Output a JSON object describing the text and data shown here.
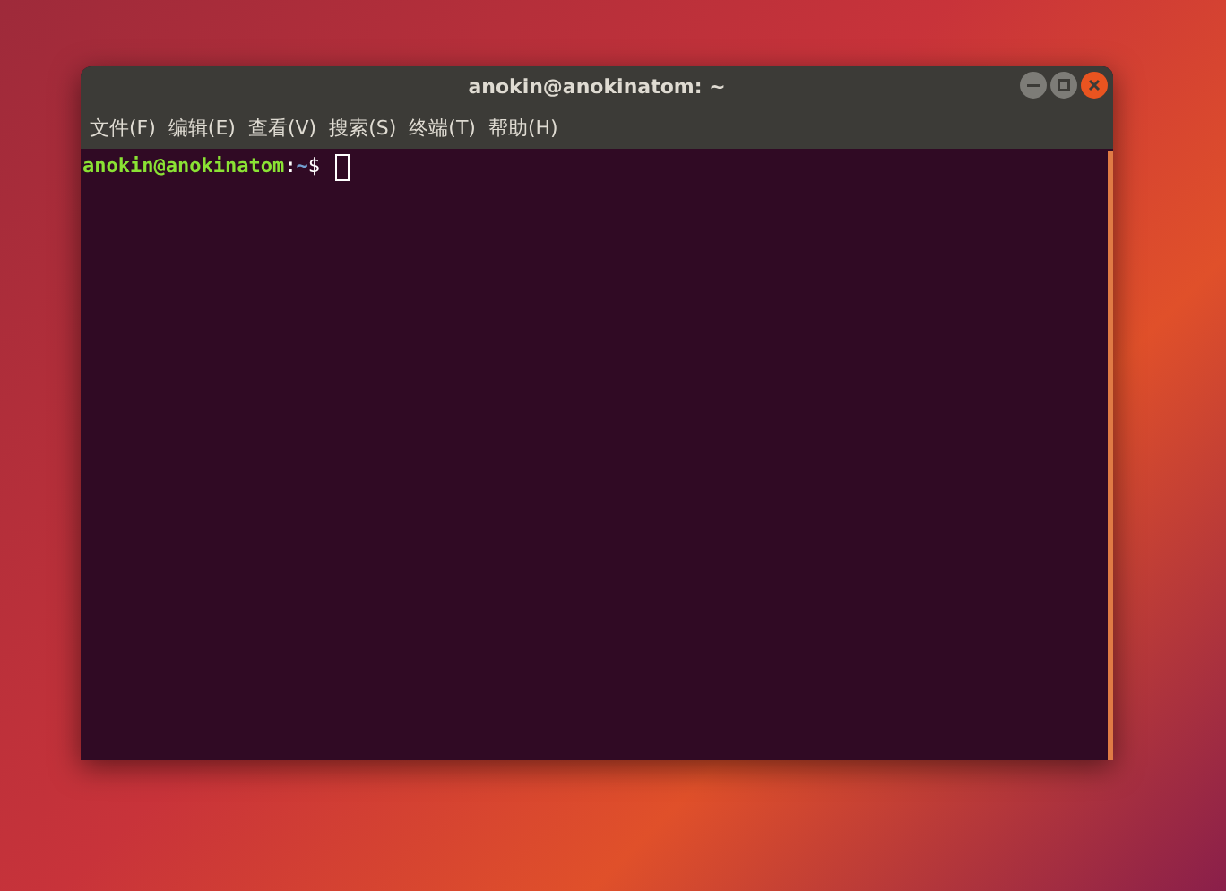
{
  "window": {
    "title": "anokin@anokinatom: ~"
  },
  "menu": [
    "文件(F)",
    "编辑(E)",
    "查看(V)",
    "搜索(S)",
    "终端(T)",
    "帮助(H)"
  ],
  "prompt": {
    "user_host": "anokin@anokinatom",
    "separator": ":",
    "path": "~",
    "symbol": "$"
  }
}
